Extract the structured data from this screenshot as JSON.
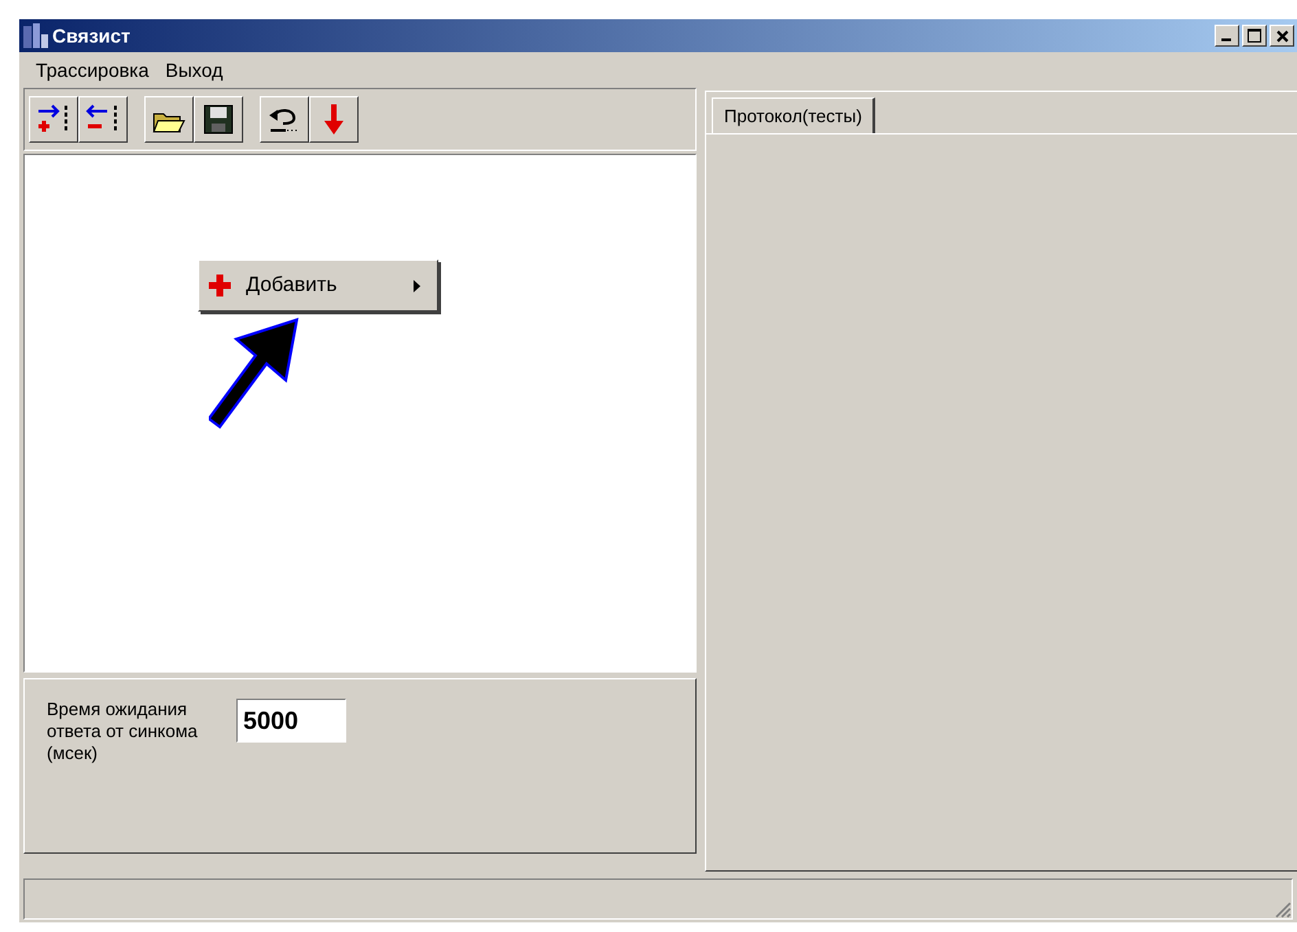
{
  "window": {
    "title": "Связист"
  },
  "menu": [
    "Трассировка",
    "Выход"
  ],
  "context_menu": {
    "items": [
      {
        "label": "Добавить",
        "has_submenu": true
      }
    ]
  },
  "settings": {
    "label": "Время ожидания ответа от синкома (мсек)",
    "value": "5000"
  },
  "tabs": [
    {
      "label": "Протокол(тесты)",
      "selected": true
    }
  ]
}
